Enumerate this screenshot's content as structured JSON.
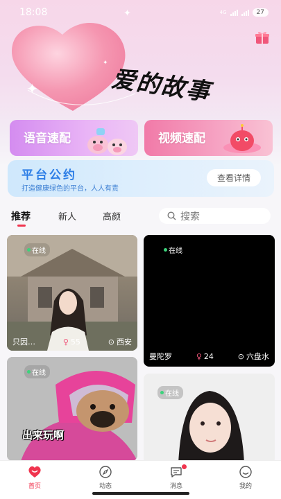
{
  "status_bar": {
    "time": "18:08",
    "network": "4G",
    "battery": "27"
  },
  "header": {
    "title": "爱的故事"
  },
  "quick_match": [
    {
      "label": "语音速配"
    },
    {
      "label": "视频速配"
    }
  ],
  "convention": {
    "title": "平台公约",
    "subtitle": "打造健康绿色的平台，人人有责",
    "button": "查看详情"
  },
  "tabs": [
    {
      "label": "推荐",
      "active": true
    },
    {
      "label": "新人",
      "active": false
    },
    {
      "label": "高颜",
      "active": false
    }
  ],
  "search": {
    "placeholder": "搜索"
  },
  "feed": [
    {
      "online": "在线",
      "name": "只因…",
      "age": "55",
      "location": "西安"
    },
    {
      "online": "在线",
      "name": "曼陀罗",
      "age": "24",
      "location": "六盘水"
    },
    {
      "online": "在线",
      "caption": "出来玩啊"
    },
    {
      "online": "在线"
    }
  ],
  "bottom_nav": [
    {
      "label": "首页",
      "active": true,
      "icon": "home-icon"
    },
    {
      "label": "动态",
      "active": false,
      "icon": "compass-icon"
    },
    {
      "label": "消息",
      "active": false,
      "icon": "message-icon",
      "badge": true
    },
    {
      "label": "我的",
      "active": false,
      "icon": "profile-icon"
    }
  ],
  "colors": {
    "accent": "#f0344e",
    "online": "#3cd37b",
    "convention_title": "#2d7ee6"
  }
}
